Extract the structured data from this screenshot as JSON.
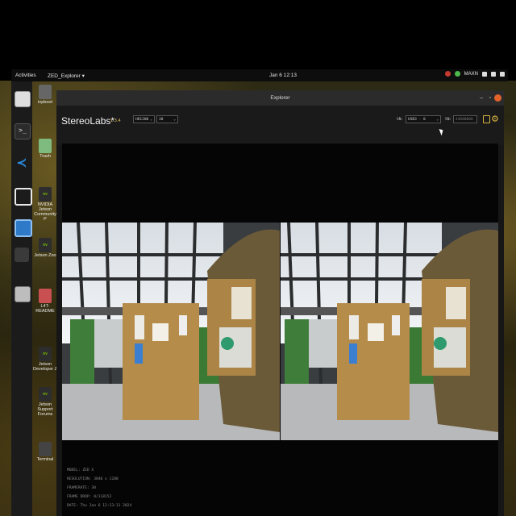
{
  "topbar": {
    "activities": "Activities",
    "app_menu": "ZED_Explorer ▾",
    "clock": "Jan 6  12:13",
    "power_mode": "MAXN"
  },
  "dock": {
    "items": [
      "files-icon",
      "terminal-icon",
      "vscode-icon",
      "obs-icon",
      "chromium-icon",
      "app-icon",
      "disk-icon"
    ]
  },
  "desktop_icons": [
    {
      "label": "inpboot"
    },
    {
      "label": "Trash"
    },
    {
      "label": "NVIDIA Jetson Community P"
    },
    {
      "label": "Jetson Zoo"
    },
    {
      "label": "L4T-README"
    },
    {
      "label": "Jetson Developer Z"
    },
    {
      "label": "Jetson Support Forums"
    },
    {
      "label": "Terminal"
    }
  ],
  "window": {
    "title": "Explorer",
    "brand": "StereoLabs",
    "version": "1.3.4",
    "resolution_select": "HD1200",
    "fps_select": "30",
    "sn_label": "SN:",
    "sn_select": "USB3 - 0",
    "sn2_label": "SN:",
    "sn_value": "44600000",
    "colors": {
      "accent": "#d8b340",
      "background": "#161616"
    }
  },
  "camera_info": {
    "model": "MODEL: ZED X",
    "resolution": "RESOLUTION: 3840 x 1200",
    "framerate": "FRAMERATE: 30",
    "frame_drop": "FRAME DROP: 0/118152",
    "date": "DATE: Thu Jan 6 12:13:11 2024"
  }
}
